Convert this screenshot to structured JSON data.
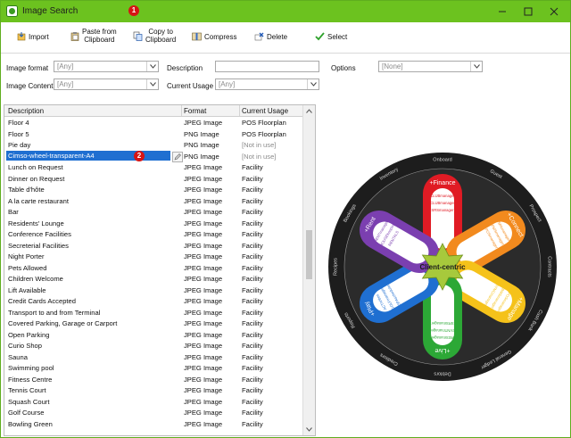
{
  "window": {
    "title": "Image Search",
    "badge": "1"
  },
  "toolbar": {
    "import": "Import",
    "paste": "Paste from\nClipboard",
    "copy": "Copy to\nClipboard",
    "compress": "Compress",
    "delete": "Delete",
    "select": "Select"
  },
  "filters": {
    "image_format_label": "Image format",
    "image_format_value": "[Any]",
    "description_label": "Description",
    "description_value": "",
    "options_label": "Options",
    "options_value": "[None]",
    "image_content_label": "Image Content",
    "image_content_value": "[Any]",
    "current_usage_label": "Current Usage",
    "current_usage_value": "[Any]"
  },
  "grid": {
    "columns": [
      "Description",
      "Format",
      "Current Usage"
    ],
    "selected_badge": "2",
    "rows": [
      [
        "Floor 4",
        "JPEG Image",
        "POS Floorplan"
      ],
      [
        "Floor 5",
        "PNG Image",
        "POS Floorplan"
      ],
      [
        "Pie day",
        "PNG Image",
        "[Not in use]"
      ],
      [
        "Cimso-wheel-transparent-A4",
        "PNG Image",
        "[Not in use]"
      ],
      [
        "Lunch on Request",
        "JPEG Image",
        "Facility"
      ],
      [
        "Dinner on Request",
        "JPEG Image",
        "Facility"
      ],
      [
        "Table d'hôte",
        "JPEG Image",
        "Facility"
      ],
      [
        "A la carte restaurant",
        "JPEG Image",
        "Facility"
      ],
      [
        "Bar",
        "JPEG Image",
        "Facility"
      ],
      [
        "Residents' Lounge",
        "JPEG Image",
        "Facility"
      ],
      [
        "Conference Facilities",
        "JPEG Image",
        "Facility"
      ],
      [
        "Secreterial Facilities",
        "JPEG Image",
        "Facility"
      ],
      [
        "Night Porter",
        "JPEG Image",
        "Facility"
      ],
      [
        "Pets Allowed",
        "JPEG Image",
        "Facility"
      ],
      [
        "Children Welcome",
        "JPEG Image",
        "Facility"
      ],
      [
        "Lift Available",
        "JPEG Image",
        "Facility"
      ],
      [
        "Credit Cards Accepted",
        "JPEG Image",
        "Facility"
      ],
      [
        "Transport to and from Terminal",
        "JPEG Image",
        "Facility"
      ],
      [
        "Covered Parking, Garage or Carport",
        "JPEG Image",
        "Facility"
      ],
      [
        "Open Parking",
        "JPEG Image",
        "Facility"
      ],
      [
        "Curio Shop",
        "JPEG Image",
        "Facility"
      ],
      [
        "Sauna",
        "JPEG Image",
        "Facility"
      ],
      [
        "Swimming pool",
        "JPEG Image",
        "Facility"
      ],
      [
        "Fitness Centre",
        "JPEG Image",
        "Facility"
      ],
      [
        "Tennis Court",
        "JPEG Image",
        "Facility"
      ],
      [
        "Squash Court",
        "JPEG Image",
        "Facility"
      ],
      [
        "Golf Course",
        "JPEG Image",
        "Facility"
      ],
      [
        "Bowling Green",
        "JPEG Image",
        "Facility"
      ]
    ]
  },
  "preview": {
    "center": "Client-centric",
    "petals": [
      {
        "title": "+Finance",
        "color": "#e01b24",
        "items": [
          "CLUBmanager",
          "CLUBmanager",
          "SRSmanager"
        ]
      },
      {
        "title": "+Connect",
        "color": "#f28a1e",
        "items": [
          "SPAmanager",
          "PMSmanager",
          "POSmanager"
        ]
      },
      {
        "title": "+Manage",
        "color": "#f5c21a",
        "items": [
          "POSmanager",
          "BMSmanager",
          "SYNCmanager"
        ]
      },
      {
        "title": "+Live",
        "color": "#2ca836",
        "items": [
          "RESmanager",
          "EVNTmanager",
          "SRSmanager"
        ]
      },
      {
        "title": "+Play",
        "color": "#1f6fd1",
        "items": [
          "ACTIVities",
          "GOLFmanager",
          "SPAscheduler"
        ]
      },
      {
        "title": "+Rent",
        "color": "#7b3fb0",
        "items": [
          "RENTmanager",
          "HOUSEkeeping",
          "RENTALS"
        ]
      }
    ],
    "ring_words": [
      "Onboard",
      "Guest",
      "Prospect",
      "Contracts",
      "Cash Bank",
      "General Ledger",
      "Debtors",
      "Creditors",
      "Reports",
      "Recipes",
      "Bookings",
      "Inventory"
    ]
  },
  "colors": {
    "titlebar": "#6cc21f",
    "selection": "#1f6fd1",
    "badge": "#d61414"
  }
}
